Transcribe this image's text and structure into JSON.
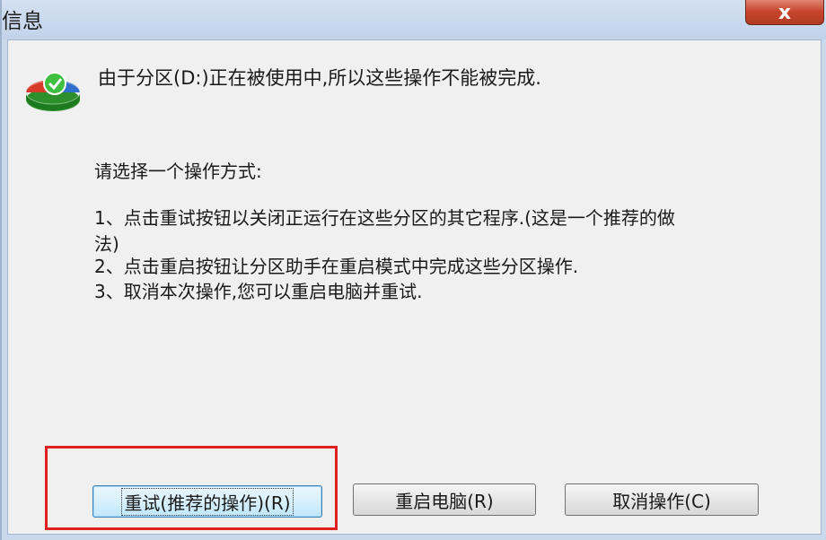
{
  "window": {
    "title": "信息",
    "close_label": "x"
  },
  "message": "由于分区(D:)正在被使用中,所以这些操作不能被完成.",
  "prompt": "请选择一个操作方式:",
  "options": [
    "1、点击重试按钮以关闭正运行在这些分区的其它程序.(这是一个推荐的做",
    "法)",
    "2、点击重启按钮让分区助手在重启模式中完成这些分区操作.",
    "3、取消本次操作,您可以重启电脑并重试."
  ],
  "buttons": {
    "retry": "重试(推荐的操作)(R)",
    "reboot": "重启电脑(R)",
    "cancel": "取消操作(C)"
  },
  "colors": {
    "highlight": "#e02020",
    "close": "#c8452d"
  },
  "icons": {
    "app": "partition-assistant-icon"
  }
}
